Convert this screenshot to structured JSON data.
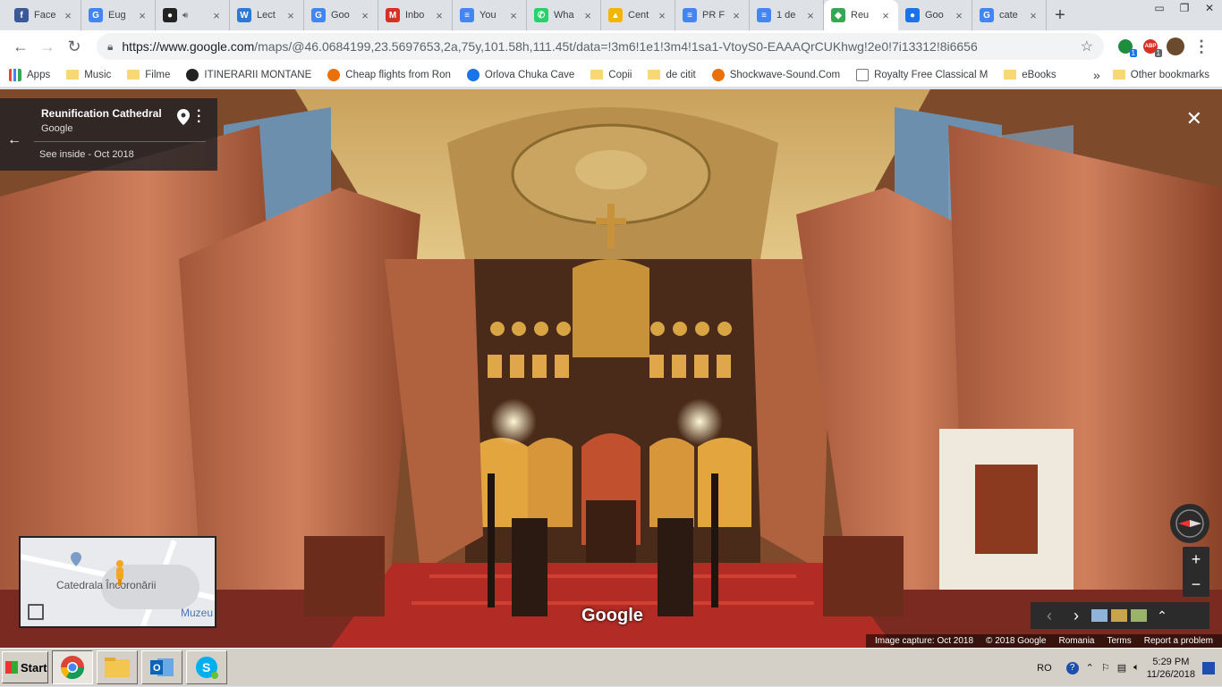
{
  "tabs": [
    {
      "label": "Face",
      "icon": "facebook-icon",
      "color": "#3b5998",
      "glyph": "f"
    },
    {
      "label": "Eug",
      "icon": "google-icon",
      "color": "#4285f4",
      "glyph": "G"
    },
    {
      "label": "",
      "icon": "spotify-icon",
      "color": "#222222",
      "glyph": "●"
    },
    {
      "label": "Lect",
      "icon": "w-icon",
      "color": "#2d7ad6",
      "glyph": "W"
    },
    {
      "label": "Goo",
      "icon": "google-translate-icon",
      "color": "#4285f4",
      "glyph": "G"
    },
    {
      "label": "Inbo",
      "icon": "gmail-icon",
      "color": "#d93025",
      "glyph": "M"
    },
    {
      "label": "You",
      "icon": "docs-icon",
      "color": "#4285f4",
      "glyph": "≡"
    },
    {
      "label": "Wha",
      "icon": "whatsapp-icon",
      "color": "#25d366",
      "glyph": "✆"
    },
    {
      "label": "Cent",
      "icon": "drive-icon",
      "color": "#f4b400",
      "glyph": "▲"
    },
    {
      "label": "PR F",
      "icon": "docs-icon",
      "color": "#4285f4",
      "glyph": "≡"
    },
    {
      "label": "1 de",
      "icon": "docs-icon",
      "color": "#4285f4",
      "glyph": "≡"
    },
    {
      "label": "Reu",
      "icon": "maps-icon",
      "color": "#34a853",
      "glyph": "◆",
      "active": true
    },
    {
      "label": "Goo",
      "icon": "google-earth-icon",
      "color": "#1a73e8",
      "glyph": "●"
    },
    {
      "label": "cate",
      "icon": "google-icon",
      "color": "#4285f4",
      "glyph": "G"
    }
  ],
  "toolbar": {
    "url_host": "https://www.google.com",
    "url_path": "/maps/@46.0684199,23.5697653,2a,75y,101.58h,111.45t/data=!3m6!1e1!3m4!1sa1-VtoyS0-EAAAQrCUKhwg!2e0!7i13312!8i6656",
    "ext1_badge": "1",
    "ext2_badge": "1",
    "ext2_label": "ABP"
  },
  "bookmarks": [
    {
      "label": "Apps",
      "type": "apps"
    },
    {
      "label": "Music",
      "type": "folder"
    },
    {
      "label": "Filme",
      "type": "folder"
    },
    {
      "label": "ITINERARII MONTANE",
      "type": "site"
    },
    {
      "label": "Cheap flights from Ron",
      "type": "site"
    },
    {
      "label": "Orlova Chuka Cave",
      "type": "site"
    },
    {
      "label": "Copii",
      "type": "folder"
    },
    {
      "label": "de citit",
      "type": "folder"
    },
    {
      "label": "Shockwave-Sound.Com",
      "type": "site"
    },
    {
      "label": "Royalty Free Classical M",
      "type": "page"
    },
    {
      "label": "eBooks",
      "type": "folder"
    }
  ],
  "bookmarks_more": "»",
  "bookmarks_other": "Other bookmarks",
  "streetview": {
    "title": "Reunification Cathedral",
    "provider": "Google",
    "see_inside": "See inside - Oct 2018",
    "minimap_label": "Catedrala Încoronării",
    "minimap_label2": "Muzeu",
    "logo": "Google",
    "footer": [
      "Image capture: Oct 2018",
      "© 2018 Google",
      "Romania",
      "Terms",
      "Report a problem"
    ]
  },
  "taskbar": {
    "start": "Start",
    "lang": "RO",
    "time": "5:29 PM",
    "date": "11/26/2018"
  }
}
